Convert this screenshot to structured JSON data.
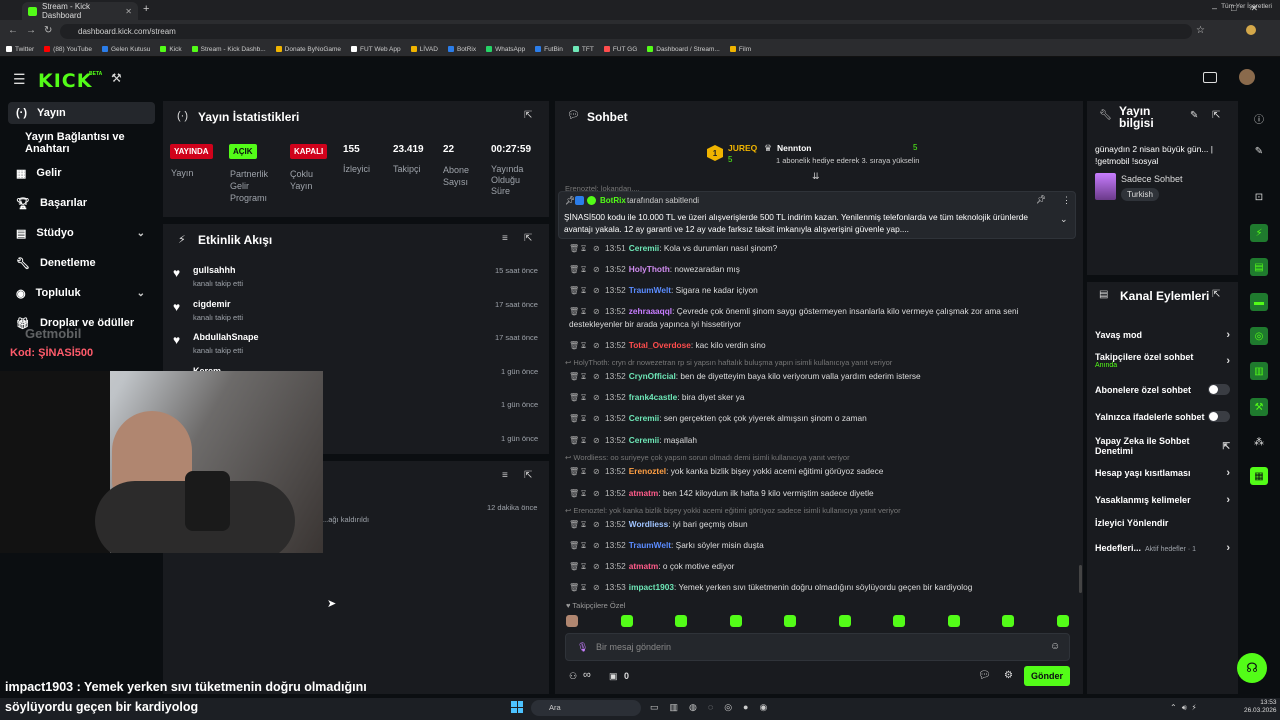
{
  "browser": {
    "tab_title": "Stream - Kick Dashboard",
    "url": "dashboard.kick.com/stream",
    "bookmarks": [
      "Twitter",
      "(88) YouTube",
      "Gelen Kutusu",
      "Kick",
      "Stream - Kick Dashb...",
      "Donate ByNoGame",
      "FUT Web App",
      "LİVAD",
      "BotRix",
      "WhatsApp",
      "FutBin",
      "TFT",
      "FUT GG",
      "Dashboard / Stream...",
      "Film"
    ],
    "all_bookmarks": "Tüm Yer İşaretleri"
  },
  "header": {
    "logo": "KICK",
    "beta": "BETA"
  },
  "sidebar": {
    "items": [
      {
        "label": "Yayın"
      },
      {
        "label": "Yayın Bağlantısı ve Anahtarı"
      },
      {
        "label": "Gelir"
      },
      {
        "label": "Başarılar"
      },
      {
        "label": "Stüdyo"
      },
      {
        "label": "Denetleme"
      },
      {
        "label": "Topluluk"
      },
      {
        "label": "Droplar ve ödüller"
      }
    ]
  },
  "overlay": {
    "promo": "Kod: ŞİNASİ500",
    "watermark": "Getmobil",
    "chat_line1": "impact1903 : Yemek yerken sıvı tüketmenin doğru olmadığını",
    "chat_line2": "söylüyordu geçen bir kardiyolog"
  },
  "stats": {
    "title": "Yayın İstatistikleri",
    "cols": [
      {
        "badge": "YAYINDA",
        "label": "Yayın"
      },
      {
        "badge": "AÇIK",
        "label": "Partnerlik Gelir Programı"
      },
      {
        "badge": "KAPALI",
        "label": "Çoklu Yayın"
      },
      {
        "value": "155",
        "label": "İzleyici"
      },
      {
        "value": "23.419",
        "label": "Takipçi"
      },
      {
        "value": "22",
        "label": "Abone Sayısı"
      },
      {
        "value": "00:27:59",
        "label": "Yayında Olduğu Süre"
      }
    ]
  },
  "activity": {
    "title": "Etkinlik Akışı",
    "items": [
      {
        "name": "gullsahhh",
        "desc": "kanalı takip etti",
        "time": "15 saat önce"
      },
      {
        "name": "cigdemir",
        "desc": "kanalı takip etti",
        "time": "17 saat önce"
      },
      {
        "name": "AbdullahSnape",
        "desc": "kanalı takip etti",
        "time": "17 saat önce"
      },
      {
        "name": "Kerem...",
        "desc": "",
        "time": "1 gün önce"
      },
      {
        "name": "",
        "desc": "",
        "time": "1 gün önce"
      },
      {
        "name": "",
        "desc": "",
        "time": "1 gün önce"
      }
    ]
  },
  "panel3": {
    "time": "12 dakika önce",
    "text": "...ağı kaldırıldı"
  },
  "chat": {
    "title": "Sohbet",
    "top": {
      "user1": "JUREQ",
      "user1_count": "5",
      "user2": "Nennton",
      "user2_count": "5",
      "gift_text": "1 abonelik hediye ederek 3. sıraya yükselin"
    },
    "pinned": {
      "by": "BotRix",
      "by_suffix": "tarafından sabitlendi",
      "text": "ŞİNASİ500 kodu ile 10.000 TL ve üzeri alışverişlerde 500 TL indirim kazan.  Yenilenmiş telefonlarda ve tüm teknolojik ürünlerde avantajı yakala. 12 ay garanti ve 12 ay vade farksız taksit imkanıyla alışverişini güvenle yap...."
    },
    "hidden_reply": "Erenoztel: lokandan....",
    "messages": [
      {
        "time": "13:51",
        "user": "Ceremii",
        "color": "#6ee7b7",
        "text": "Kola vs durumları nasıl şinom?"
      },
      {
        "time": "13:52",
        "user": "HolyThoth",
        "color": "#d08cf0",
        "text": "nowezaradan mış"
      },
      {
        "time": "13:52",
        "user": "TraumWelt",
        "color": "#5b8cff",
        "text": "Sigara ne kadar içiyon"
      },
      {
        "time": "13:52",
        "user": "zehraaaqql",
        "color": "#c77dff",
        "text": "Çevrede çok önemli şinom saygı göstermeyen insanlarla kilo vermeye çalışmak zor ama seni destekleyenler bir arada yapınca iyi hissetiriyor"
      },
      {
        "time": "13:52",
        "user": "Total_Overdose",
        "color": "#ff4d4d",
        "text": "kac kilo verdin sino"
      },
      {
        "reply": "HolyThoth: cryn dr nowezetran rp si yapsın haftalık buluşma yapın isimli kullanıcıya yanıt veriyor"
      },
      {
        "time": "13:52",
        "user": "CrynOfficial",
        "color": "#6ee7b7",
        "text": "ben de diyetteyim baya kilo veriyorum valla yardım ederim isterse"
      },
      {
        "time": "13:52",
        "user": "frank4castle",
        "color": "#6ee7b7",
        "text": "bira diyet sker ya"
      },
      {
        "time": "13:52",
        "user": "Ceremii",
        "color": "#6ee7b7",
        "text": "sen gerçekten çok çok yiyerek almışsın şinom o zaman"
      },
      {
        "time": "13:52",
        "user": "Ceremii",
        "color": "#6ee7b7",
        "text": "maşallah"
      },
      {
        "reply": "Wordliess: oo suriyeye çok yapsın sorun olmadı demi isimli kullanıcıya yanıt veriyor"
      },
      {
        "time": "13:52",
        "user": "Erenoztel",
        "color": "#ff9f43",
        "text": "yok kanka bizlik bişey yokki acemi eğitimi görüyoz sadece"
      },
      {
        "time": "13:52",
        "user": "atmatm",
        "color": "#ff5c8a",
        "text": "ben 142 kiloydum ilk hafta 9 kilo vermiştim sadece diyetle"
      },
      {
        "reply": "Erenoztel: yok kanka bizlik bişey yokki acemi eğitimi görüyoz sadece isimli kullanıcıya yanıt veriyor"
      },
      {
        "time": "13:52",
        "user": "Wordliess",
        "color": "#a0c4ff",
        "text": "iyi bari geçmiş olsun"
      },
      {
        "time": "13:52",
        "user": "TraumWelt",
        "color": "#5b8cff",
        "text": "Şarkı söyler misin duşta"
      },
      {
        "time": "13:52",
        "user": "atmatm",
        "color": "#ff5c8a",
        "text": "o çok motive ediyor"
      },
      {
        "time": "13:53",
        "user": "impact1903",
        "color": "#6ee7b7",
        "text": "Yemek yerken sıvı tüketmenin doğru olmadığını söylüyordu geçen bir kardiyolog"
      }
    ],
    "followers_only": "Takipçilere Özel",
    "input_placeholder": "Bir mesaj gönderin",
    "counter_left": "∞",
    "counter_right": "0",
    "send_label": "Gönder"
  },
  "stream_info": {
    "title": "Yayın bilgisi",
    "stream_title": "günaydın 2 nisan büyük gün... | !getmobil !sosyal",
    "category": "Sadece Sohbet",
    "language": "Turkish"
  },
  "channel_actions": {
    "title": "Kanal Eylemleri",
    "items": [
      {
        "label": "Yavaş mod",
        "type": "arrow"
      },
      {
        "label": "Takipçilere özel sohbet",
        "sub": "Anında",
        "type": "arrow"
      },
      {
        "label": "Abonelere özel sohbet",
        "type": "toggle"
      },
      {
        "label": "Yalnızca ifadelerle sohbet",
        "type": "toggle"
      },
      {
        "label": "Yapay Zeka ile Sohbet Denetimi",
        "type": "external"
      },
      {
        "label": "Hesap yaşı kısıtlaması",
        "type": "arrow"
      },
      {
        "label": "Yasaklanmış kelimeler",
        "type": "arrow"
      },
      {
        "label": "İzleyici Yönlendir",
        "type": "none"
      },
      {
        "label": "Hedefleri...",
        "sub": "Aktif hedefler · 1",
        "type": "arrow"
      }
    ]
  },
  "taskbar": {
    "search": "Ara",
    "time": "13:53",
    "date": "26.03.2026"
  },
  "colors": {
    "accent": "#53fc18",
    "live": "#e4002b",
    "panel": "#191b1f",
    "bg": "#0b0e11"
  }
}
